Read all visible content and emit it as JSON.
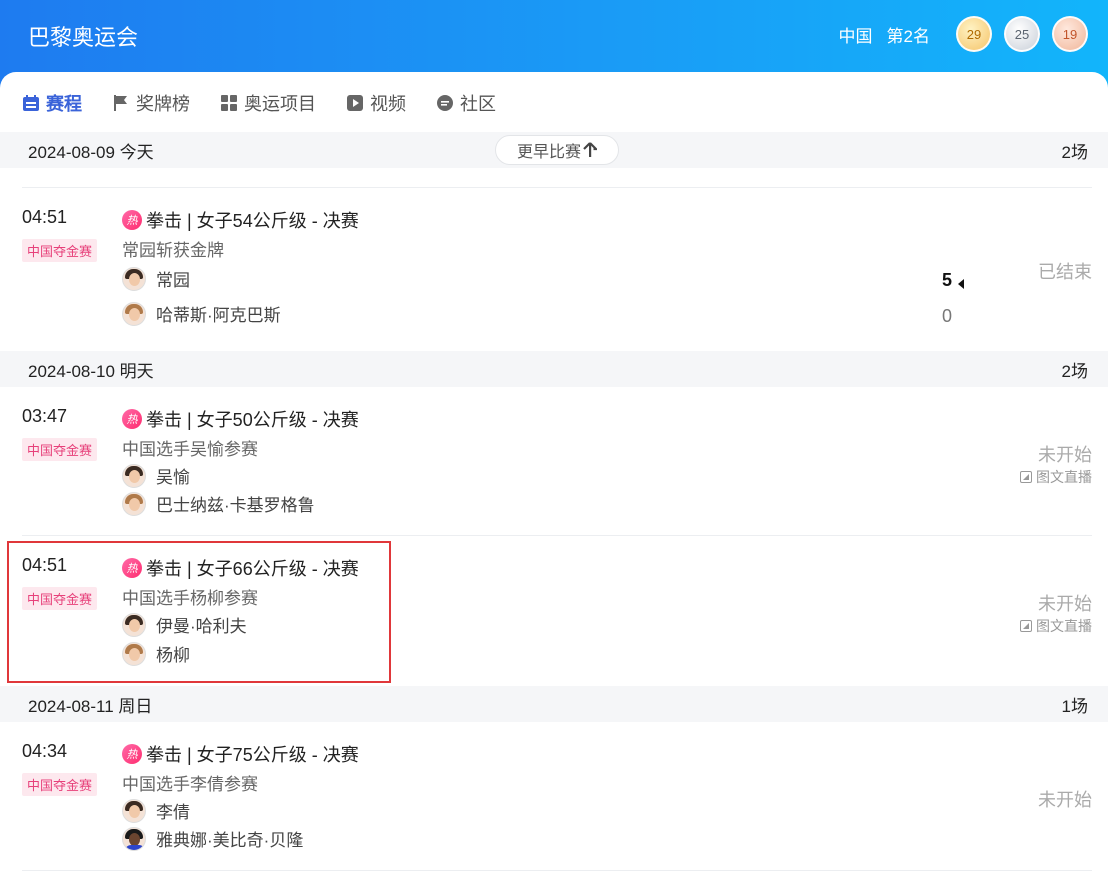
{
  "header": {
    "title": "巴黎奥运会",
    "country": "中国",
    "rank": "第2名",
    "medals": {
      "gold": "29",
      "silver": "25",
      "bronze": "19"
    }
  },
  "tabs": [
    {
      "label": "赛程",
      "icon": "calendar-icon",
      "active": true
    },
    {
      "label": "奖牌榜",
      "icon": "flag-icon"
    },
    {
      "label": "奥运项目",
      "icon": "grid-icon"
    },
    {
      "label": "视频",
      "icon": "play-icon"
    },
    {
      "label": "社区",
      "icon": "chat-icon"
    }
  ],
  "days": [
    {
      "date": "2024-08-09 今天",
      "count": "2场",
      "more_label": "更早比赛",
      "matches": [
        {
          "time": "04:51",
          "tag": "中国夺金赛",
          "hot": "热",
          "title": "拳击 | 女子54公斤级 - 决赛",
          "subtitle": "常园斩获金牌",
          "players": [
            {
              "name": "常园",
              "score": "5",
              "winner": true
            },
            {
              "name": "哈蒂斯·阿克巴斯",
              "score": "0"
            }
          ],
          "status": "已结束"
        }
      ]
    },
    {
      "date": "2024-08-10 明天",
      "count": "2场",
      "matches": [
        {
          "time": "03:47",
          "tag": "中国夺金赛",
          "hot": "热",
          "title": "拳击 | 女子50公斤级 - 决赛",
          "subtitle": "中国选手吴愉参赛",
          "players": [
            {
              "name": "吴愉"
            },
            {
              "name": "巴士纳兹·卡基罗格鲁"
            }
          ],
          "status": "未开始",
          "live": "图文直播"
        },
        {
          "time": "04:51",
          "tag": "中国夺金赛",
          "hot": "热",
          "title": "拳击 | 女子66公斤级 - 决赛",
          "subtitle": "中国选手杨柳参赛",
          "players": [
            {
              "name": "伊曼·哈利夫"
            },
            {
              "name": "杨柳"
            }
          ],
          "status": "未开始",
          "live": "图文直播"
        }
      ]
    },
    {
      "date": "2024-08-11 周日",
      "count": "1场",
      "matches": [
        {
          "time": "04:34",
          "tag": "中国夺金赛",
          "hot": "热",
          "title": "拳击 | 女子75公斤级 - 决赛",
          "subtitle": "中国选手李倩参赛",
          "players": [
            {
              "name": "李倩"
            },
            {
              "name": "雅典娜·美比奇·贝隆"
            }
          ],
          "status": "未开始"
        }
      ]
    }
  ],
  "colors": {
    "header_start": "#1e7bf0",
    "header_end": "#12b5fb",
    "tab_active": "#3a63d9",
    "tag_text": "#e7407a",
    "tag_bg": "#fde8ee",
    "highlight_border": "#e0373a"
  }
}
